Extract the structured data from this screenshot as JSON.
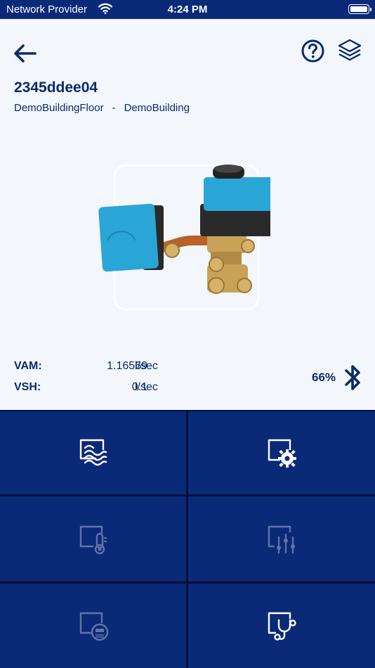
{
  "status_bar": {
    "carrier": "Network Provider",
    "time": "4:24 PM"
  },
  "header": {
    "back_icon": "arrow-left-icon",
    "help_icon": "question-circle-icon",
    "layers_icon": "layers-icon"
  },
  "device": {
    "id": "2345ddee04",
    "floor": "DemoBuildingFloor",
    "separator": "-",
    "building": "DemoBuilding"
  },
  "readings": [
    {
      "label": "VAM:",
      "value": "1.16569",
      "unit": "l/sec"
    },
    {
      "label": "VSH:",
      "value": "0.1",
      "unit": "l/sec"
    }
  ],
  "bluetooth": {
    "signal": "66%",
    "icon": "bluetooth-icon"
  },
  "tiles": [
    {
      "name": "flow-icon",
      "enabled": true
    },
    {
      "name": "settings-icon",
      "enabled": true
    },
    {
      "name": "temperature-icon",
      "enabled": false
    },
    {
      "name": "sliders-icon",
      "enabled": false
    },
    {
      "name": "meter-icon",
      "enabled": false
    },
    {
      "name": "diagnostics-icon",
      "enabled": true
    }
  ],
  "colors": {
    "primary": "#0a2a78",
    "background": "#f3f6fb",
    "text": "#0a2a6b",
    "valve_blue": "#2aa6d6",
    "brass": "#c9a25a"
  }
}
